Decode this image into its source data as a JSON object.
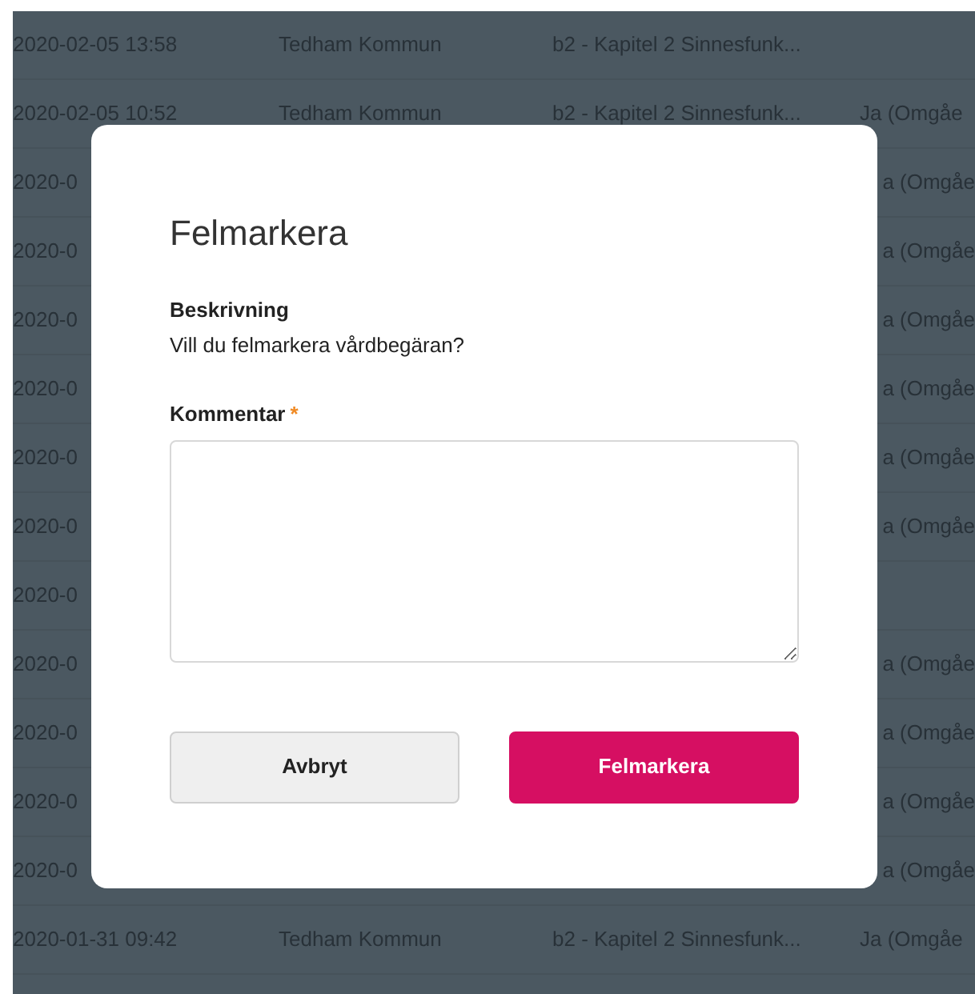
{
  "table": {
    "rows": [
      {
        "kind": "full",
        "cells": [
          "2020-02-05 13:58",
          "Tedham Kommun",
          "b2 - Kapitel 2 Sinnesfunk..."
        ]
      },
      {
        "kind": "full",
        "cells": [
          "2020-02-05 10:52",
          "Tedham Kommun",
          "b2 - Kapitel 2 Sinnesfunk...",
          "Ja (Omgåe"
        ]
      },
      {
        "kind": "covered",
        "cells": [
          "2020-0",
          "a (Omgåe"
        ]
      },
      {
        "kind": "covered",
        "cells": [
          "2020-0",
          "a (Omgåe"
        ]
      },
      {
        "kind": "covered",
        "cells": [
          "2020-0",
          "a (Omgåe"
        ]
      },
      {
        "kind": "covered",
        "cells": [
          "2020-0",
          "a (Omgåe"
        ]
      },
      {
        "kind": "covered",
        "cells": [
          "2020-0",
          "a (Omgåe"
        ]
      },
      {
        "kind": "covered",
        "cells": [
          "2020-0",
          "a (Omgåe"
        ]
      },
      {
        "kind": "covered",
        "cells": [
          "2020-0"
        ]
      },
      {
        "kind": "covered",
        "cells": [
          "2020-0",
          "a (Omgåe"
        ]
      },
      {
        "kind": "covered",
        "cells": [
          "2020-0",
          "a (Omgåe"
        ]
      },
      {
        "kind": "covered",
        "cells": [
          "2020-0",
          "a (Omgåe"
        ]
      },
      {
        "kind": "covered",
        "cells": [
          "2020-0",
          "a (Omgåe"
        ]
      },
      {
        "kind": "full",
        "cells": [
          "2020-01-31 09:42",
          "Tedham Kommun",
          "b2 - Kapitel 2 Sinnesfunk...",
          "Ja (Omgåe"
        ]
      }
    ]
  },
  "dialog": {
    "title": "Felmarkera",
    "description_label": "Beskrivning",
    "description": "Vill du felmarkera vårdbegäran?",
    "comment_label": "Kommentar",
    "required_mark": "*",
    "buttons": [
      {
        "label": "Avbryt",
        "kind": "secondary"
      },
      {
        "label": "Felmarkera",
        "kind": "primary"
      }
    ]
  }
}
